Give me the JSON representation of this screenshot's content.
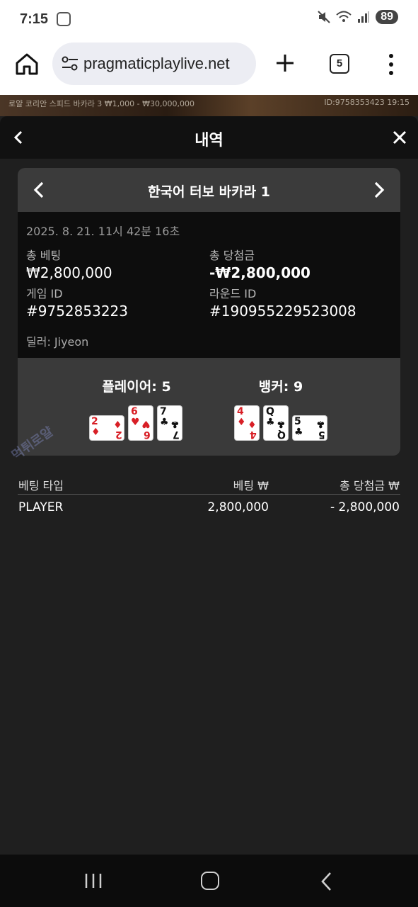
{
  "status_bar": {
    "time": "7:15",
    "battery": "89"
  },
  "browser": {
    "url": "pragmaticplaylive.net",
    "tab_count": "5"
  },
  "game_strip": {
    "left_text": "로얄 코리안 스피드 바카라 3  ₩1,000 - ₩30,000,000",
    "right_text": "ID:9758353423  19:15"
  },
  "panel": {
    "title": "내역"
  },
  "card": {
    "title": "한국어 터보 바카라 1",
    "datetime": "2025. 8. 21. 11시 42분 16초",
    "total_bet_label": "총 베팅",
    "total_bet_value": "₩2,800,000",
    "total_win_label": "총 당첨금",
    "total_win_value": "-₩2,800,000",
    "game_id_label": "게임 ID",
    "game_id_value": "#9752853223",
    "round_id_label": "라운드 ID",
    "round_id_value": "#190955229523008",
    "dealer": "딜러: Jiyeon"
  },
  "result": {
    "player_label": "플레이어: 5",
    "banker_label": "뱅커: 9",
    "player_cards": [
      {
        "rank": "2",
        "suit": "♦",
        "color": "#d81f26",
        "sideways": true
      },
      {
        "rank": "6",
        "suit": "♥",
        "color": "#d81f26",
        "sideways": false
      },
      {
        "rank": "7",
        "suit": "♣",
        "color": "#111111",
        "sideways": false
      }
    ],
    "banker_cards": [
      {
        "rank": "4",
        "suit": "♦",
        "color": "#d81f26",
        "sideways": false
      },
      {
        "rank": "Q",
        "suit": "♣",
        "color": "#111111",
        "sideways": false
      },
      {
        "rank": "5",
        "suit": "♣",
        "color": "#111111",
        "sideways": true
      }
    ]
  },
  "table": {
    "headers": [
      "베팅 타입",
      "베팅 ₩",
      "총 당첨금 ₩"
    ],
    "rows": [
      {
        "type": "PLAYER",
        "bet": "2,800,000",
        "win": "- 2,800,000"
      }
    ]
  },
  "watermark": "먹튀로얄"
}
